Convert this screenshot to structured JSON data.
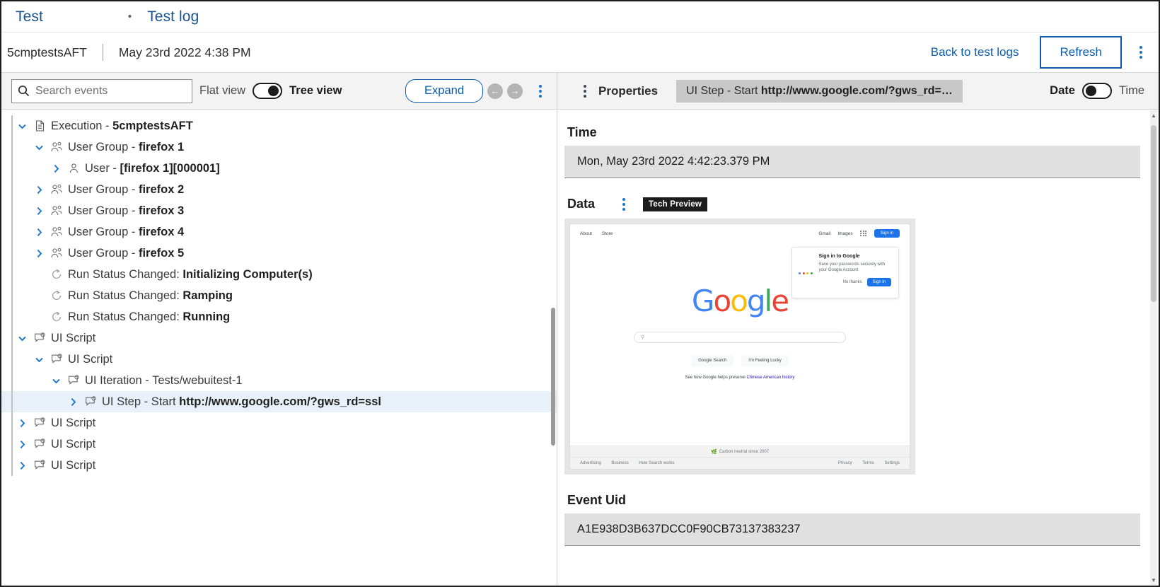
{
  "breadcrumb": {
    "root": "Test",
    "separator": "•",
    "current": "Test log"
  },
  "subheader": {
    "run_name": "5cmptestsAFT",
    "run_date": "May 23rd 2022 4:38 PM",
    "back_link": "Back to test logs",
    "refresh_label": "Refresh",
    "menu_icon": "kebab-menu-icon"
  },
  "left_toolbar": {
    "search_placeholder": "Search events",
    "search_value": "",
    "search_icon": "search-icon",
    "flat_view_label": "Flat view",
    "tree_view_label": "Tree view",
    "toggle_state": "Tree view",
    "expand_label": "Expand",
    "prev_icon": "arrow-left-icon",
    "next_icon": "arrow-right-icon",
    "menu_icon": "kebab-menu-icon"
  },
  "tree": {
    "nodes": [
      {
        "depth": 0,
        "chevron": "down",
        "icon": "document-icon",
        "prefix": "Execution - ",
        "bold": "5cmptestsAFT",
        "selected": false
      },
      {
        "depth": 1,
        "chevron": "down",
        "icon": "user-group-icon",
        "prefix": "User Group - ",
        "bold": "firefox 1",
        "selected": false
      },
      {
        "depth": 2,
        "chevron": "right",
        "icon": "user-icon",
        "prefix": "User - ",
        "bold": "[firefox 1][000001]",
        "selected": false
      },
      {
        "depth": 1,
        "chevron": "right",
        "icon": "user-group-icon",
        "prefix": "User Group - ",
        "bold": "firefox 2",
        "selected": false
      },
      {
        "depth": 1,
        "chevron": "right",
        "icon": "user-group-icon",
        "prefix": "User Group - ",
        "bold": "firefox 3",
        "selected": false
      },
      {
        "depth": 1,
        "chevron": "right",
        "icon": "user-group-icon",
        "prefix": "User Group - ",
        "bold": "firefox 4",
        "selected": false
      },
      {
        "depth": 1,
        "chevron": "right",
        "icon": "user-group-icon",
        "prefix": "User Group - ",
        "bold": "firefox 5",
        "selected": false
      },
      {
        "depth": 1,
        "chevron": "none",
        "icon": "status-icon",
        "prefix": "Run Status Changed: ",
        "bold": "Initializing Computer(s)",
        "selected": false
      },
      {
        "depth": 1,
        "chevron": "none",
        "icon": "status-icon",
        "prefix": "Run Status Changed: ",
        "bold": "Ramping",
        "selected": false
      },
      {
        "depth": 1,
        "chevron": "none",
        "icon": "status-icon",
        "prefix": "Run Status Changed: ",
        "bold": "Running",
        "selected": false
      },
      {
        "depth": 0,
        "chevron": "down",
        "icon": "script-icon",
        "prefix": "UI Script",
        "bold": "",
        "selected": false
      },
      {
        "depth": 1,
        "chevron": "down",
        "icon": "script-icon",
        "prefix": "UI Script",
        "bold": "",
        "selected": false
      },
      {
        "depth": 2,
        "chevron": "down",
        "icon": "script-icon",
        "prefix": "UI Iteration - Tests/webuitest-1",
        "bold": "",
        "selected": false
      },
      {
        "depth": 3,
        "chevron": "right",
        "icon": "script-icon",
        "prefix": "UI Step - Start ",
        "bold": "http://www.google.com/?gws_rd=ssl",
        "selected": true
      },
      {
        "depth": 0,
        "chevron": "right",
        "icon": "script-icon",
        "prefix": "UI Script",
        "bold": "",
        "selected": false
      },
      {
        "depth": 0,
        "chevron": "right",
        "icon": "script-icon",
        "prefix": "UI Script",
        "bold": "",
        "selected": false
      },
      {
        "depth": 0,
        "chevron": "right",
        "icon": "script-icon",
        "prefix": "UI Script",
        "bold": "",
        "selected": false
      }
    ]
  },
  "right_header": {
    "menu_icon": "kebab-menu-icon",
    "properties_label": "Properties",
    "event_chip_prefix": "UI Step - Start ",
    "event_chip_bold": "http://www.google.com/?gws_rd=…",
    "date_label": "Date",
    "time_label": "Time",
    "toggle_state": "Date"
  },
  "properties": {
    "time_label": "Time",
    "time_value": "Mon, May 23rd 2022 4:42:23.379 PM",
    "data_label": "Data",
    "data_menu_icon": "kebab-menu-icon",
    "data_badge": "Tech Preview",
    "event_uid_label": "Event Uid",
    "event_uid_value": "A1E938D3B637DCC0F90CB73137383237"
  },
  "screenshot": {
    "top_links": [
      "About",
      "Store"
    ],
    "top_right_links": [
      "Gmail",
      "Images"
    ],
    "apps_icon": "google-apps-grid-icon",
    "signin_button": "Sign in",
    "popup": {
      "title": "Sign in to Google",
      "text": "Save your passwords securely with your Google Account",
      "no_thanks": "No thanks",
      "signin": "Sign in"
    },
    "logo": "Google",
    "search_icon": "magnifier-icon",
    "search_value": "",
    "buttons": [
      "Google Search",
      "I'm Feeling Lucky"
    ],
    "promo_prefix": "See how Google helps preserve ",
    "promo_link": "Chinese American history",
    "carbon_text": "Carbon neutral since 2007",
    "carbon_icon": "leaf-icon",
    "footer_left": [
      "Advertising",
      "Business",
      "How Search works"
    ],
    "footer_right": [
      "Privacy",
      "Terms",
      "Settings"
    ]
  },
  "colors": {
    "link_blue": "#0b5cab",
    "accent_blue": "#1a73c8",
    "selected_row": "#e8f0f9",
    "toolbar_bg": "#f3f3f3",
    "field_bg": "#e0e0e0"
  }
}
